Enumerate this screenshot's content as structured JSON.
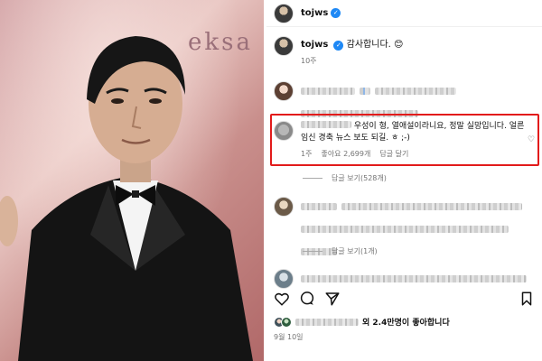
{
  "photo": {
    "backdrop_text": "eksa"
  },
  "profile": {
    "username": "tojws"
  },
  "post": {
    "username": "tojws",
    "caption": "감사합니다. 😊",
    "time": "10주"
  },
  "highlighted_comment": {
    "text_line1": "우성이 형, 열애설이라니요, 정말 실망입니다. 얼른",
    "text_line2": "임신 경축 뉴스 보도 되길. ㅎ ;-)",
    "time": "1주",
    "likes": "좋아요 2,699개",
    "reply": "답글 달기"
  },
  "replies": [
    {
      "label": "답글 보기(528개)"
    },
    {
      "label": "답글 보기(1개)"
    }
  ],
  "likes_summary": {
    "text": "외 2.4만명이 좋아합니다"
  },
  "post_date": "9월 10일",
  "colors": {
    "highlight": "#e21b1b",
    "verified": "#1e88f5"
  },
  "icons": [
    "heart-icon",
    "comment-icon",
    "share-icon",
    "bookmark-icon",
    "verified-icon"
  ]
}
